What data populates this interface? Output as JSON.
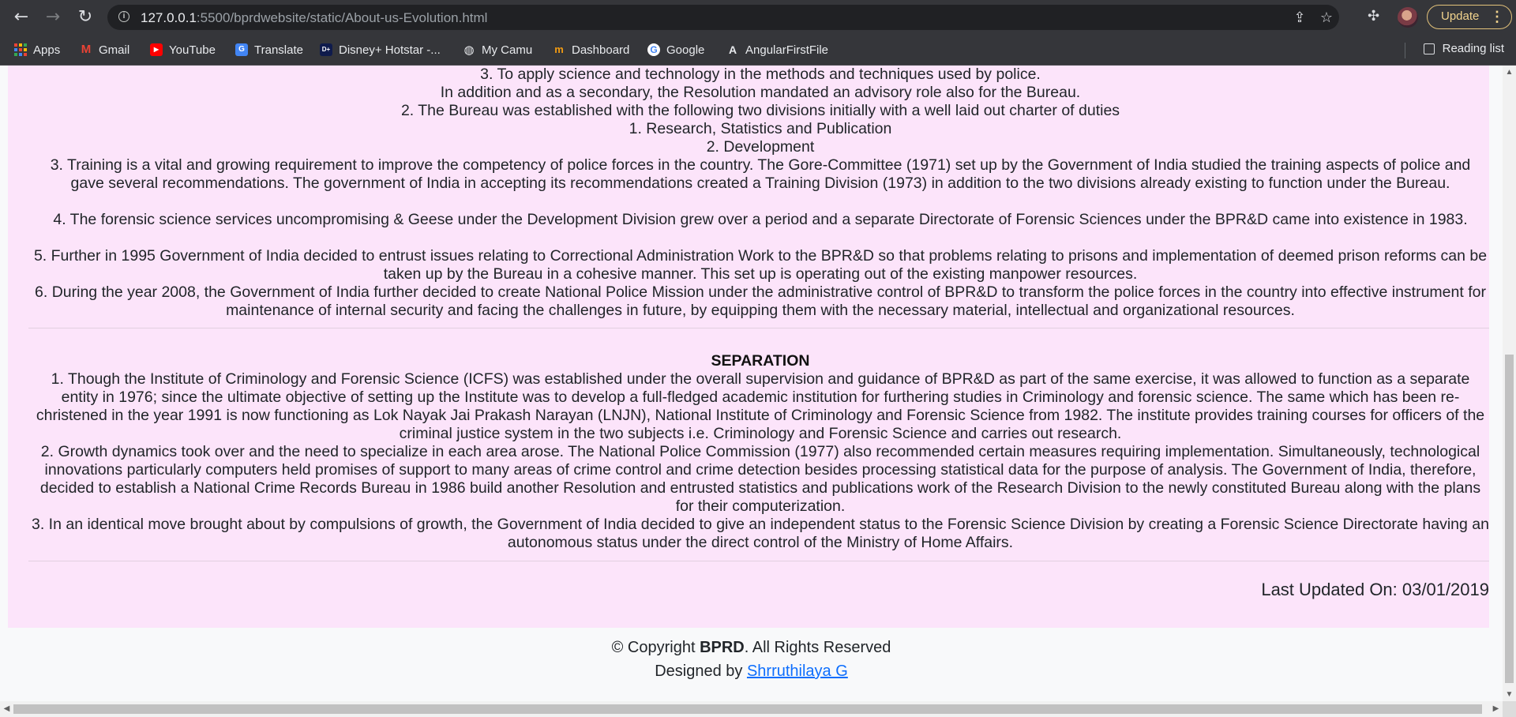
{
  "browser": {
    "url_host": "127.0.0.1",
    "url_rest": ":5500/bprdwebsite/static/About-us-Evolution.html",
    "update_label": "Update",
    "reading_list": "Reading list",
    "bookmarks": [
      {
        "label": "Apps",
        "icon": "apps-grid-icon"
      },
      {
        "label": "Gmail",
        "icon": "gmail-icon"
      },
      {
        "label": "YouTube",
        "icon": "youtube-icon"
      },
      {
        "label": "Translate",
        "icon": "translate-icon"
      },
      {
        "label": "Disney+ Hotstar -...",
        "icon": "hotstar-icon"
      },
      {
        "label": "My Camu",
        "icon": "globe-icon"
      },
      {
        "label": "Dashboard",
        "icon": "dashboard-icon"
      },
      {
        "label": "Google",
        "icon": "google-icon"
      },
      {
        "label": "AngularFirstFile",
        "icon": "angular-icon"
      }
    ]
  },
  "evolution": {
    "lines": [
      "3. To apply science and technology in the methods and techniques used by police.",
      "In addition and as a secondary, the Resolution mandated an advisory role also for the Bureau.",
      "2. The Bureau was established with the following two divisions initially with a well laid out charter of duties",
      "1. Research, Statistics and Publication",
      "2. Development",
      "3. Training is a vital and growing requirement to improve the competency of police forces in the country. The Gore-Committee (1971) set up by the Government of India studied the training aspects of police and gave several recommendations. The government of India in accepting its recommendations created a Training Division (1973) in addition to the two divisions already existing to function under the Bureau.",
      "4. The forensic science services uncompromising & Geese under the Development Division grew over a period and a separate Directorate of Forensic Sciences under the BPR&D came into existence in 1983.",
      "5. Further in 1995 Government of India decided to entrust issues relating to Correctional Administration Work to the BPR&D so that problems relating to prisons and implementation of deemed prison reforms can be taken up by the Bureau in a cohesive manner. This set up is operating out of the existing manpower resources.",
      "6. During the year 2008, the Government of India further decided to create National Police Mission under the administrative control of BPR&D to transform the police forces in the country into effective instrument for maintenance of internal security and facing the challenges in future, by equipping them with the necessary material, intellectual and organizational resources."
    ]
  },
  "separation": {
    "title": "SEPARATION",
    "paragraphs": [
      "1. Though the Institute of Criminology and Forensic Science (ICFS) was established under the overall supervision and guidance of BPR&D as part of the same exercise, it was allowed to function as a separate entity in 1976; since the ultimate objective of setting up the Institute was to develop a full-fledged academic institution for furthering studies in Criminology and forensic science. The same which has been re-christened in the year 1991 is now functioning as Lok Nayak Jai Prakash Narayan (LNJN), National Institute of Criminology and Forensic Science from 1982. The institute provides training courses for officers of the criminal justice system in the two subjects i.e. Criminology and Forensic Science and carries out research.",
      "2. Growth dynamics took over and the need to specialize in each area arose. The National Police Commission (1977) also recommended certain measures requiring implementation. Simultaneously, technological innovations particularly computers held promises of support to many areas of crime control and crime detection besides processing statistical data for the purpose of analysis. The Government of India, therefore, decided to establish a National Crime Records Bureau in 1986 build another Resolution and entrusted statistics and publications work of the Research Division to the newly constituted Bureau along with the plans for their computerization.",
      "3. In an identical move brought about by compulsions of growth, the Government of India decided to give an independent status to the Forensic Science Division by creating a Forensic Science Directorate having an autonomous status under the direct control of the Ministry of Home Affairs."
    ]
  },
  "last_updated": "Last Updated On: 03/01/2019",
  "footer": {
    "copyright_prefix": "© Copyright ",
    "brand": "BPRD",
    "copyright_suffix": ". All Rights Reserved",
    "designed_by": "Designed by ",
    "designer": "Shrruthilaya G"
  },
  "colors": {
    "content_bg": "#fce4fa",
    "link": "#0d6efd",
    "chrome_bg": "#35363a"
  }
}
